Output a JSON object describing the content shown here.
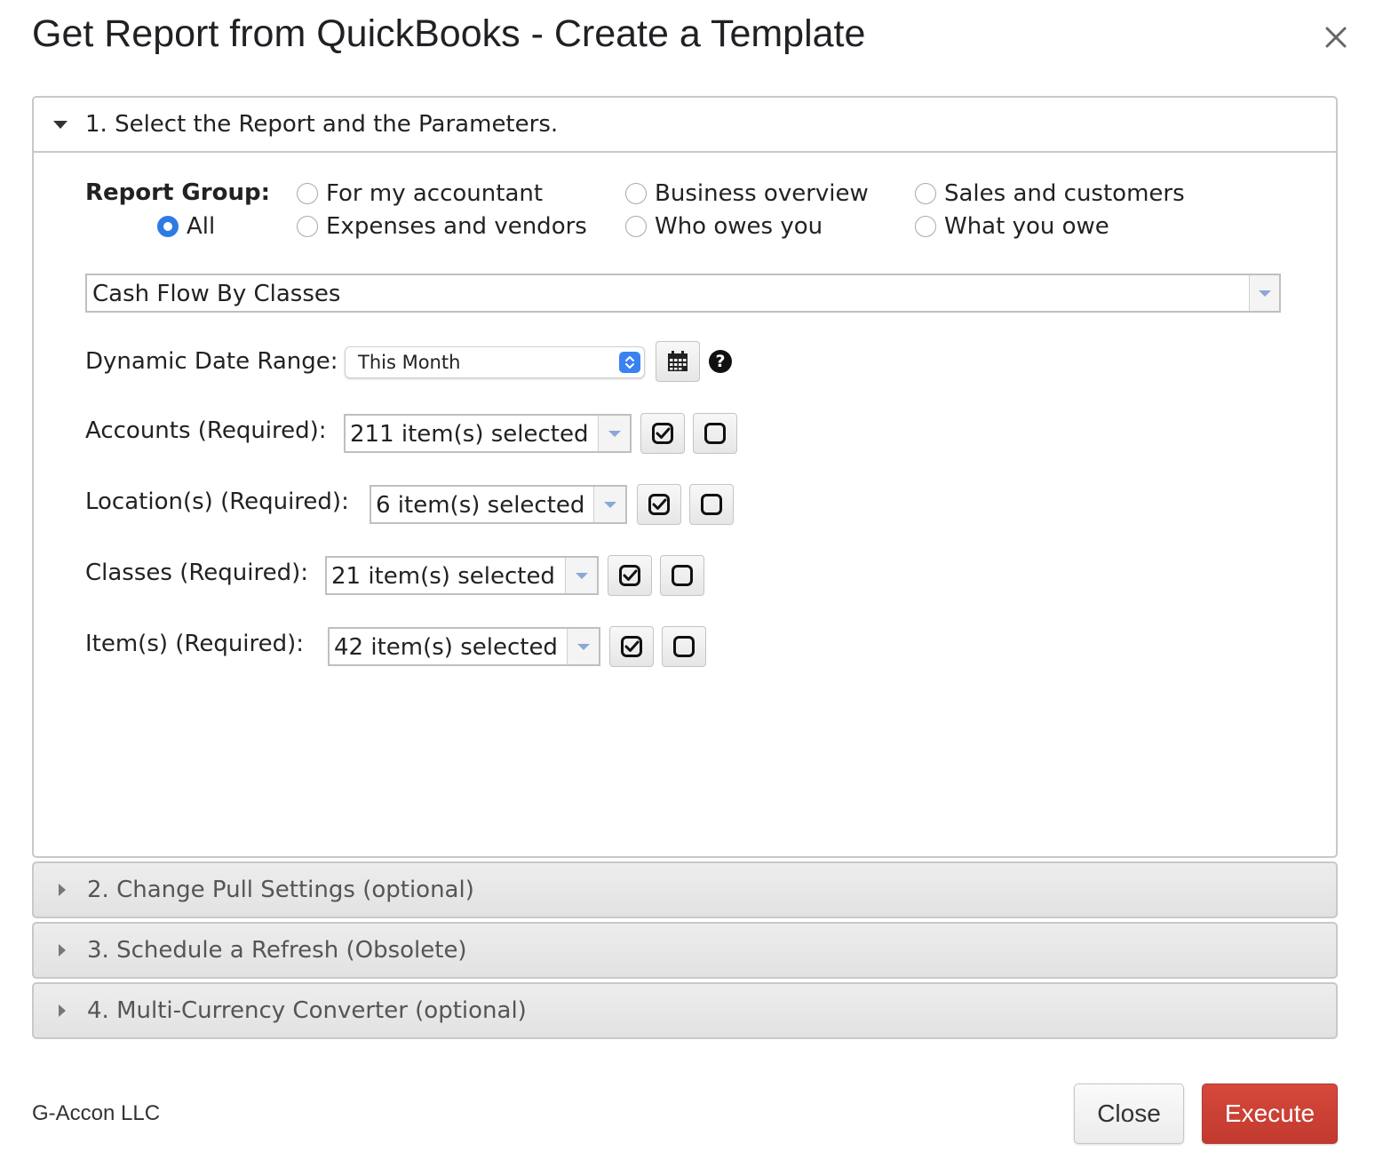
{
  "dialog": {
    "title": "Get Report from QuickBooks - Create a Template"
  },
  "sections": [
    {
      "label": "1. Select the Report and the Parameters.",
      "expanded": true
    },
    {
      "label": "2. Change Pull Settings (optional)",
      "expanded": false
    },
    {
      "label": "3. Schedule a Refresh (Obsolete)",
      "expanded": false
    },
    {
      "label": "4. Multi-Currency Converter (optional)",
      "expanded": false
    }
  ],
  "report_group": {
    "label": "Report Group:",
    "options": [
      {
        "label": "All",
        "selected": true
      },
      {
        "label": "For my accountant",
        "selected": false
      },
      {
        "label": "Expenses and vendors",
        "selected": false
      },
      {
        "label": "Business overview",
        "selected": false
      },
      {
        "label": "Who owes you",
        "selected": false
      },
      {
        "label": "Sales and customers",
        "selected": false
      },
      {
        "label": "What you owe",
        "selected": false
      }
    ],
    "accent_color": "#2f7be5"
  },
  "report": {
    "selected": "Cash Flow By Classes"
  },
  "date_range": {
    "label": "Dynamic Date Range:",
    "value": "This Month"
  },
  "filters": [
    {
      "label": "Accounts (Required):",
      "value": "211 item(s) selected"
    },
    {
      "label": "Location(s) (Required):",
      "value": "6 item(s) selected"
    },
    {
      "label": "Classes (Required):",
      "value": "21 item(s) selected"
    },
    {
      "label": "Item(s) (Required):",
      "value": "42 item(s) selected"
    }
  ],
  "footer": {
    "brand": "G-Accon LLC",
    "close_label": "Close",
    "execute_label": "Execute",
    "execute_color": "#c9463b"
  }
}
